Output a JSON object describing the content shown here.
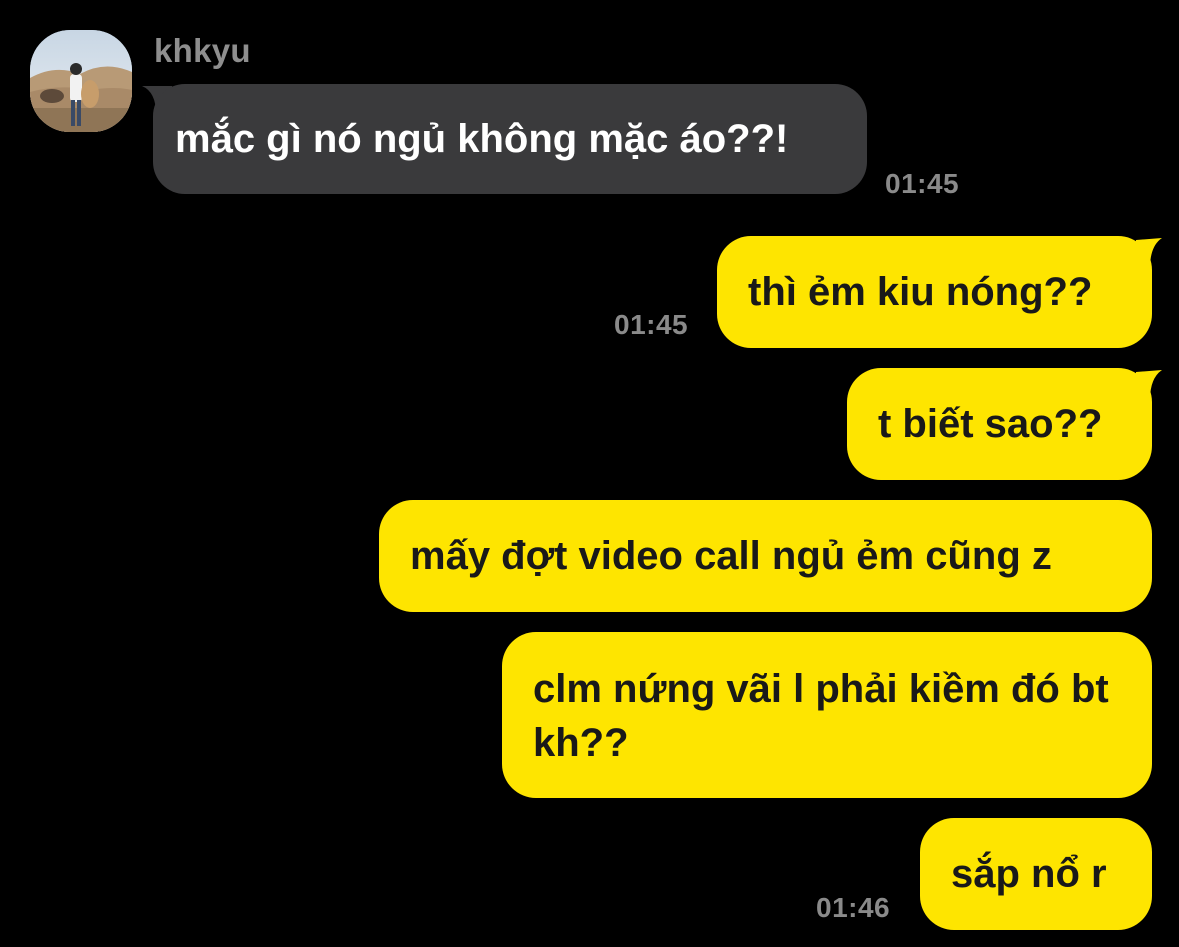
{
  "chat": {
    "incoming": {
      "sender_name": "khkyu",
      "avatar": "profile-photo",
      "messages": [
        {
          "text": "mắc gì nó ngủ không mặc áo??!",
          "time": "01:45"
        }
      ]
    },
    "outgoing": {
      "messages": [
        {
          "text": "thì ẻm kiu nóng??",
          "time": "01:45"
        },
        {
          "text": "t biết sao??"
        },
        {
          "text": "mấy đợt video call ngủ ẻm cũng z"
        },
        {
          "text": "clm nứng vãi l phải kiềm đó bt kh??"
        },
        {
          "text": "sắp nổ r",
          "time": "01:46"
        }
      ]
    }
  },
  "colors": {
    "background": "#000000",
    "incoming_bubble": "#3a3a3c",
    "outgoing_bubble": "#fee500",
    "timestamp": "#8a8a8a",
    "sender_name": "#8e8e8e"
  }
}
